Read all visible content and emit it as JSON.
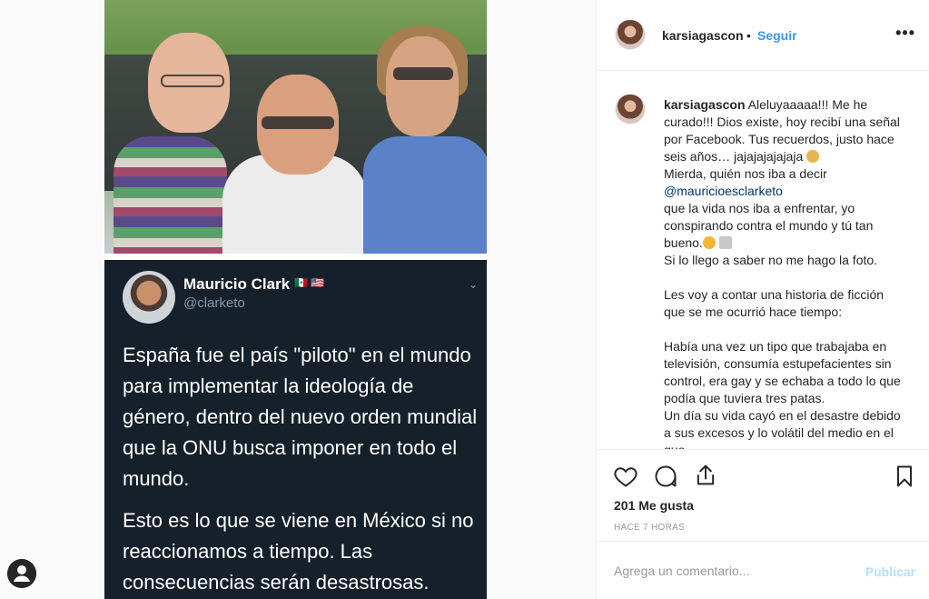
{
  "post": {
    "username": "karsiagascon",
    "dot": "•",
    "follow_label": "Seguir",
    "more_label": "•••",
    "caption": {
      "username": "karsiagascon",
      "line1": "Aleluyaaaaa!!! Me he curado!!! Dios existe, hoy recibí una señal por Facebook. Tus recuerdos, justo hace seis años… jajajajajajaja",
      "line1b": "Mierda, quién nos iba a decir",
      "mention": "@mauricioesclarketo",
      "line1c": "que la vida nos iba a enfrentar, yo conspirando contra el mundo y tú tan bueno.",
      "line1d": "Si lo llego a saber no me hago la foto.",
      "para2": "Les voy a contar una historia de ficción que se me ocurrió hace tiempo:",
      "para3": "Había una vez un tipo que trabajaba en televisión, consumía estupefacientes sin control, era gay y se echaba a todo lo que podía que tuviera tres patas.\nUn día su vida cayó en el desastre debido a sus excesos y lo volátil del medio en el que..."
    },
    "likes": "201 Me gusta",
    "time": "HACE 7 HORAS",
    "comment_placeholder": "Agrega un comentario...",
    "publish_label": "Publicar"
  },
  "tweet": {
    "name": "Mauricio Clark",
    "flags": "🇲🇽 🇺🇸",
    "handle": "@clarketo",
    "para1": "España fue el país \"piloto\" en el mundo para implementar la ideología de género, dentro del nuevo orden mundial que la ONU busca imponer en todo el mundo.",
    "para2": "Esto es lo que se viene en México si no reaccionamos a tiempo. Las consecuencias serán desastrosas."
  },
  "icons": {
    "like": "heart-icon",
    "comment": "comment-icon",
    "share": "share-icon",
    "save": "bookmark-icon",
    "more": "more-options-icon",
    "user": "user-icon"
  },
  "colors": {
    "link": "#3897f0",
    "tweet_bg": "#15202b",
    "publish_disabled": "#b2dffc"
  }
}
